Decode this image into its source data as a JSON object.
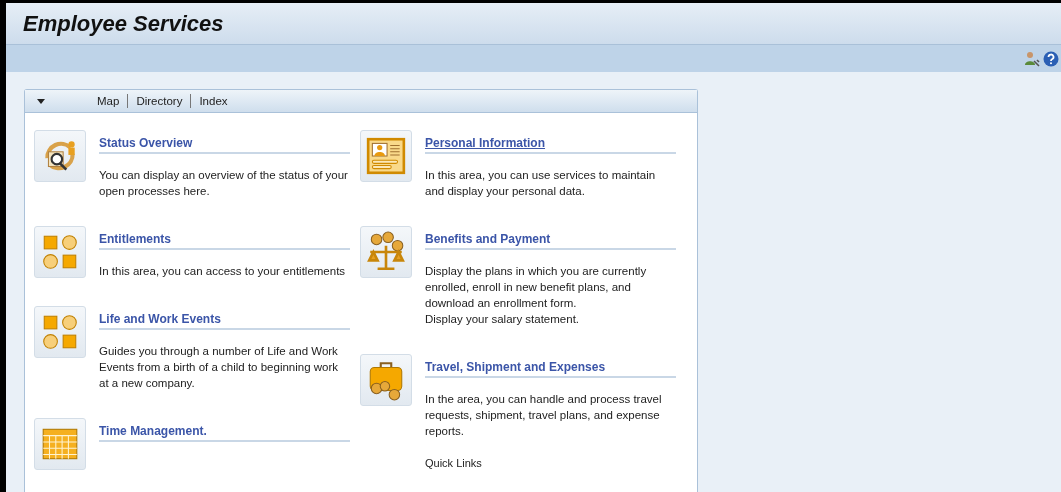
{
  "window": {
    "title": "Employee Services"
  },
  "nav": {
    "links": [
      {
        "label": "Map"
      },
      {
        "label": "Directory"
      },
      {
        "label": "Index"
      }
    ]
  },
  "columns": [
    {
      "items": [
        {
          "kind": "status",
          "title": "Status Overview",
          "hovered": false,
          "lines": [
            "You can display an overview of the status of your open processes here."
          ]
        },
        {
          "kind": "shapes",
          "title": "Entitlements",
          "hovered": false,
          "lines": [
            "In this area, you can access to your entitlements"
          ]
        },
        {
          "kind": "shapes",
          "title": "Life and Work Events",
          "hovered": false,
          "lines": [
            "Guides you through a number of Life and Work Events from a birth of a child to beginning work at a new company."
          ]
        },
        {
          "kind": "calendar",
          "title": "Time Management.",
          "hovered": false
        }
      ]
    },
    {
      "items": [
        {
          "kind": "card",
          "title": "Personal Information",
          "hovered": true,
          "lines": [
            "In this area, you can use services to maintain and display your personal data."
          ]
        },
        {
          "kind": "scales",
          "title": "Benefits and Payment",
          "hovered": false,
          "lines": [
            "Display the plans in which you are currently enrolled, enroll in new benefit plans, and download an enrollment form.",
            "Display your salary statement."
          ]
        },
        {
          "kind": "suitcase",
          "title": "Travel, Shipment and Expenses",
          "hovered": false,
          "lines": [
            "In the area, you can handle and process travel requests, shipment, travel plans, and expense reports."
          ],
          "quick_links": "Quick Links"
        }
      ]
    }
  ]
}
